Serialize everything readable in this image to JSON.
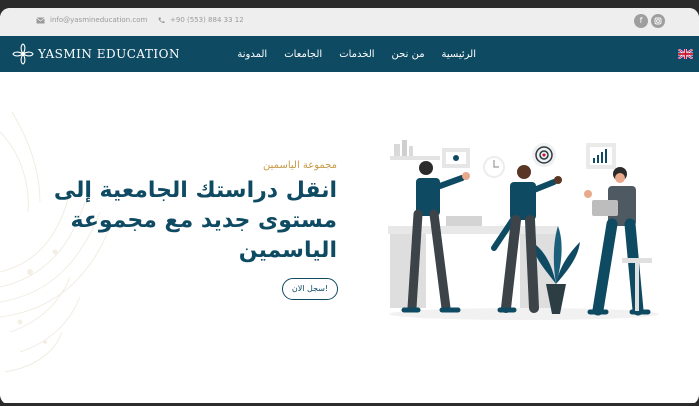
{
  "topbar": {
    "email": "info@yasmineducation.com",
    "phone": "+90 (553) 884 33 12",
    "social": [
      {
        "icon": "facebook-icon",
        "glyph": "f"
      },
      {
        "icon": "instagram-icon",
        "glyph": "◙"
      }
    ]
  },
  "navbar": {
    "logo_text": "YASMIN EDUCATION",
    "items": [
      {
        "label": "الرئيسية"
      },
      {
        "label": "من نحن"
      },
      {
        "label": "الخدمات"
      },
      {
        "label": "الجامعات"
      },
      {
        "label": "المدونة"
      }
    ],
    "language_flag": "uk-flag-icon"
  },
  "hero": {
    "subtitle": "مجموعة الياسمين",
    "headline": "انقل دراستك الجامعية إلى مستوى جديد مع مجموعة الياسمين",
    "cta_label": "!سجل الان"
  },
  "colors": {
    "navbar_bg": "#0f4a63",
    "accent_gold": "#c89a46",
    "topbar_bg": "#eeeeee"
  }
}
